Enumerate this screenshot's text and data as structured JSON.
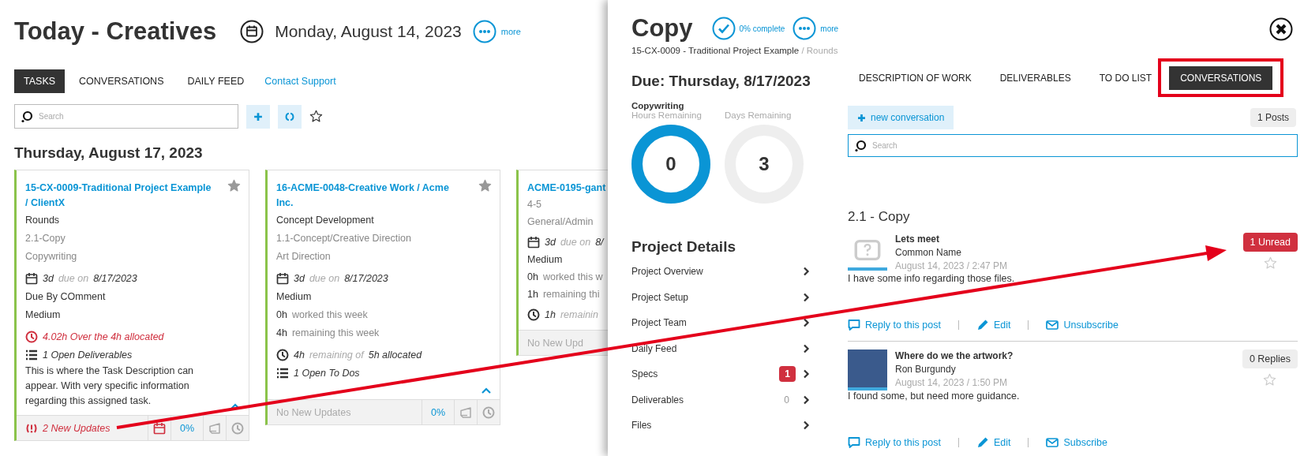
{
  "header": {
    "title": "Today - Creatives",
    "date": "Monday, August 14, 2023",
    "more": "more"
  },
  "tabs": [
    {
      "label": "TASKS",
      "selected": true
    },
    {
      "label": "CONVERSATIONS",
      "selected": false
    },
    {
      "label": "DAILY FEED",
      "selected": false
    }
  ],
  "support_link": "Contact Support",
  "search": {
    "placeholder": "Search"
  },
  "day_heading": "Thursday, August 17, 2023",
  "cards": [
    {
      "title": "15-CX-0009-Traditional Project Example / ClientX",
      "pinned": true,
      "expanded": true,
      "lines": [
        {
          "kind": "text",
          "muted": false,
          "text": "Rounds"
        },
        {
          "kind": "text",
          "muted": true,
          "text": "2.1-Copy"
        },
        {
          "kind": "text",
          "muted": true,
          "text": "Copywriting"
        },
        {
          "kind": "due",
          "days": "3d",
          "label": "due on",
          "date": "8/17/2023"
        },
        {
          "kind": "text",
          "muted": false,
          "text": "Due By COmment"
        },
        {
          "kind": "text",
          "muted": false,
          "text": "Medium"
        },
        {
          "kind": "over",
          "text": "4.02h Over the 4h allocated"
        },
        {
          "kind": "open",
          "text": "1 Open Deliverables"
        },
        {
          "kind": "description",
          "text": "This is where the Task Description can appear. With very specific information regarding this assigned task."
        }
      ],
      "footer": {
        "text": "2 New Updates",
        "alert": true,
        "calendar_alert": true,
        "percent": "0%"
      }
    },
    {
      "title": "16-ACME-0048-Creative Work / Acme Inc.",
      "pinned": true,
      "expanded": true,
      "lines": [
        {
          "kind": "text",
          "muted": false,
          "text": "Concept Development"
        },
        {
          "kind": "text",
          "muted": true,
          "text": "1.1-Concept/Creative Direction"
        },
        {
          "kind": "text",
          "muted": true,
          "text": "Art Direction"
        },
        {
          "kind": "due",
          "days": "3d",
          "label": "due on",
          "date": "8/17/2023"
        },
        {
          "kind": "text",
          "muted": false,
          "text": "Medium"
        },
        {
          "kind": "hours",
          "amount": "0h",
          "label": "worked this week"
        },
        {
          "kind": "hours",
          "amount": "4h",
          "label": "remaining this week"
        },
        {
          "kind": "allocation",
          "amount": "4h",
          "label": "remaining of",
          "total": "5h allocated"
        },
        {
          "kind": "open",
          "text": "1 Open To Dos"
        }
      ],
      "footer": {
        "text": "No New Updates",
        "alert": false,
        "calendar_alert": false,
        "percent": "0%"
      }
    },
    {
      "title": "ACME-0195-gant",
      "lines": [
        {
          "kind": "text",
          "muted": true,
          "text": "4-5"
        },
        {
          "kind": "text",
          "muted": true,
          "text": "General/Admin"
        },
        {
          "kind": "due",
          "days": "3d",
          "label": "due on",
          "date": "8/"
        },
        {
          "kind": "text",
          "muted": false,
          "text": "Medium"
        },
        {
          "kind": "hours",
          "amount": "0h",
          "label": "worked this w"
        },
        {
          "kind": "hours",
          "amount": "1h",
          "label": "remaining thi"
        },
        {
          "kind": "allocation",
          "amount": "1h",
          "label": "remainin"
        }
      ],
      "footer": {
        "text": "No New Upd",
        "alert": false,
        "calendar_alert": false
      }
    }
  ],
  "panel": {
    "title": "Copy",
    "complete": "0% complete",
    "more": "more",
    "breadcrumb": {
      "project": "15-CX-0009 - Traditional Project Example",
      "phase": "/ Rounds"
    },
    "due": "Due: Thursday, 8/17/2023",
    "category": "Copywriting",
    "gauges": [
      {
        "label": "Hours Remaining",
        "value": "0",
        "level": 1
      },
      {
        "label": "Days Remaining",
        "value": "3",
        "level": 0
      }
    ],
    "details_title": "Project Details",
    "details": [
      {
        "label": "Project Overview"
      },
      {
        "label": "Project Setup"
      },
      {
        "label": "Project Team"
      },
      {
        "label": "Daily Feed"
      },
      {
        "label": "Specs",
        "badge": "1"
      },
      {
        "label": "Deliverables",
        "count": "0"
      },
      {
        "label": "Files"
      }
    ],
    "tabs": [
      {
        "label": "DESCRIPTION OF WORK",
        "selected": false,
        "highlighted": false
      },
      {
        "label": "DELIVERABLES",
        "selected": false,
        "highlighted": false
      },
      {
        "label": "TO DO LIST",
        "selected": false,
        "highlighted": false
      },
      {
        "label": "CONVERSATIONS",
        "selected": true,
        "highlighted": true
      }
    ],
    "new_button": "new conversation",
    "posts_count": "1 Posts",
    "search": {
      "placeholder": "Search"
    },
    "section": "2.1 - Copy",
    "posts": [
      {
        "avatar": {
          "kind": "placeholder"
        },
        "title": "Lets meet",
        "author": "Common Name",
        "time": "August 14, 2023 / 2:47 PM",
        "body": "I have some info regarding those files.",
        "badge": {
          "kind": "unread",
          "text": "1 Unread"
        },
        "starred": false,
        "actions": [
          {
            "kind": "reply",
            "label": "Reply to this post"
          },
          {
            "kind": "edit",
            "label": "Edit"
          },
          {
            "kind": "subscribe",
            "label": "Unsubscribe"
          }
        ]
      },
      {
        "avatar": {
          "kind": "photo"
        },
        "title": "Where do we the artwork?",
        "author": "Ron Burgundy",
        "time": "August 14, 2023 / 1:50 PM",
        "body": "I found some, but need more guidance.",
        "badge": {
          "kind": "replies",
          "text": "0 Replies"
        },
        "starred": false,
        "actions": [
          {
            "kind": "reply",
            "label": "Reply to this post"
          },
          {
            "kind": "edit",
            "label": "Edit"
          },
          {
            "kind": "subscribe",
            "label": "Subscribe"
          }
        ]
      }
    ]
  }
}
